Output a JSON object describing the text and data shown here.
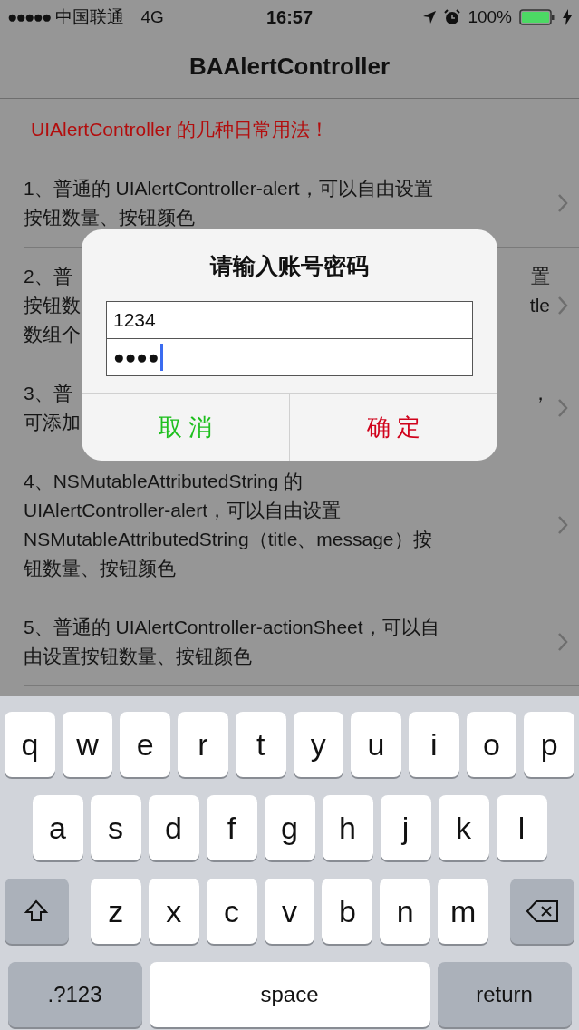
{
  "status_bar": {
    "signal_dots": "●●●●●",
    "carrier": "中国联通",
    "network": "4G",
    "time": "16:57",
    "battery": "100%",
    "charging": true
  },
  "nav_bar": {
    "title": "BAAlertController"
  },
  "header": {
    "text": "UIAlertController 的几种日常用法！"
  },
  "rows": [
    {
      "lines": [
        {
          "left": "1、普通的 UIAlertController-alert，可以自由设置"
        },
        {
          "left": "按钮数量、按钮颜色"
        }
      ]
    },
    {
      "lines": [
        {
          "left": "2、普",
          "right": "置"
        },
        {
          "left": "按钮数",
          "right": "tle"
        },
        {
          "left": "数组个"
        }
      ]
    },
    {
      "lines": [
        {
          "left": "3、普",
          "right": "，"
        },
        {
          "left": "可添加"
        }
      ]
    },
    {
      "lines": [
        {
          "left": "4、NSMutableAttributedString 的"
        },
        {
          "left": "UIAlertController-alert，可以自由设置"
        },
        {
          "left": "NSMutableAttributedString（title、message）按"
        },
        {
          "left": "钮数量、按钮颜色"
        }
      ]
    },
    {
      "lines": [
        {
          "left": "5、普通的 UIAlertController-actionSheet，可以自"
        },
        {
          "left": "由设置按钮数量、按钮颜色"
        }
      ]
    }
  ],
  "alert": {
    "title": "请输入账号密码",
    "fields": [
      {
        "value": "1234",
        "focused": false
      },
      {
        "value": "●●●●",
        "focused": true
      }
    ],
    "buttons": [
      {
        "label": "取 消",
        "color": "#1dbf1d"
      },
      {
        "label": "确 定",
        "color": "#d0021b"
      }
    ]
  },
  "keyboard": {
    "letter_rows": [
      [
        {
          "kind": "key",
          "label": "q"
        },
        {
          "kind": "key",
          "label": "w"
        },
        {
          "kind": "key",
          "label": "e"
        },
        {
          "kind": "key",
          "label": "r"
        },
        {
          "kind": "key",
          "label": "t"
        },
        {
          "kind": "key",
          "label": "y"
        },
        {
          "kind": "key",
          "label": "u"
        },
        {
          "kind": "key",
          "label": "i"
        },
        {
          "kind": "key",
          "label": "o"
        },
        {
          "kind": "key",
          "label": "p"
        }
      ],
      [
        {
          "kind": "key",
          "label": "a"
        },
        {
          "kind": "key",
          "label": "s"
        },
        {
          "kind": "key",
          "label": "d"
        },
        {
          "kind": "key",
          "label": "f"
        },
        {
          "kind": "key",
          "label": "g"
        },
        {
          "kind": "key",
          "label": "h"
        },
        {
          "kind": "key",
          "label": "j"
        },
        {
          "kind": "key",
          "label": "k"
        },
        {
          "kind": "key",
          "label": "l"
        }
      ],
      [
        {
          "kind": "shift"
        },
        {
          "kind": "key",
          "label": "z"
        },
        {
          "kind": "key",
          "label": "x"
        },
        {
          "kind": "key",
          "label": "c"
        },
        {
          "kind": "key",
          "label": "v"
        },
        {
          "kind": "key",
          "label": "b"
        },
        {
          "kind": "key",
          "label": "n"
        },
        {
          "kind": "key",
          "label": "m"
        },
        {
          "kind": "delete"
        }
      ]
    ],
    "bottom_bar": {
      "mode_key": ".?123",
      "space_key": "space",
      "return_key": "return"
    }
  }
}
